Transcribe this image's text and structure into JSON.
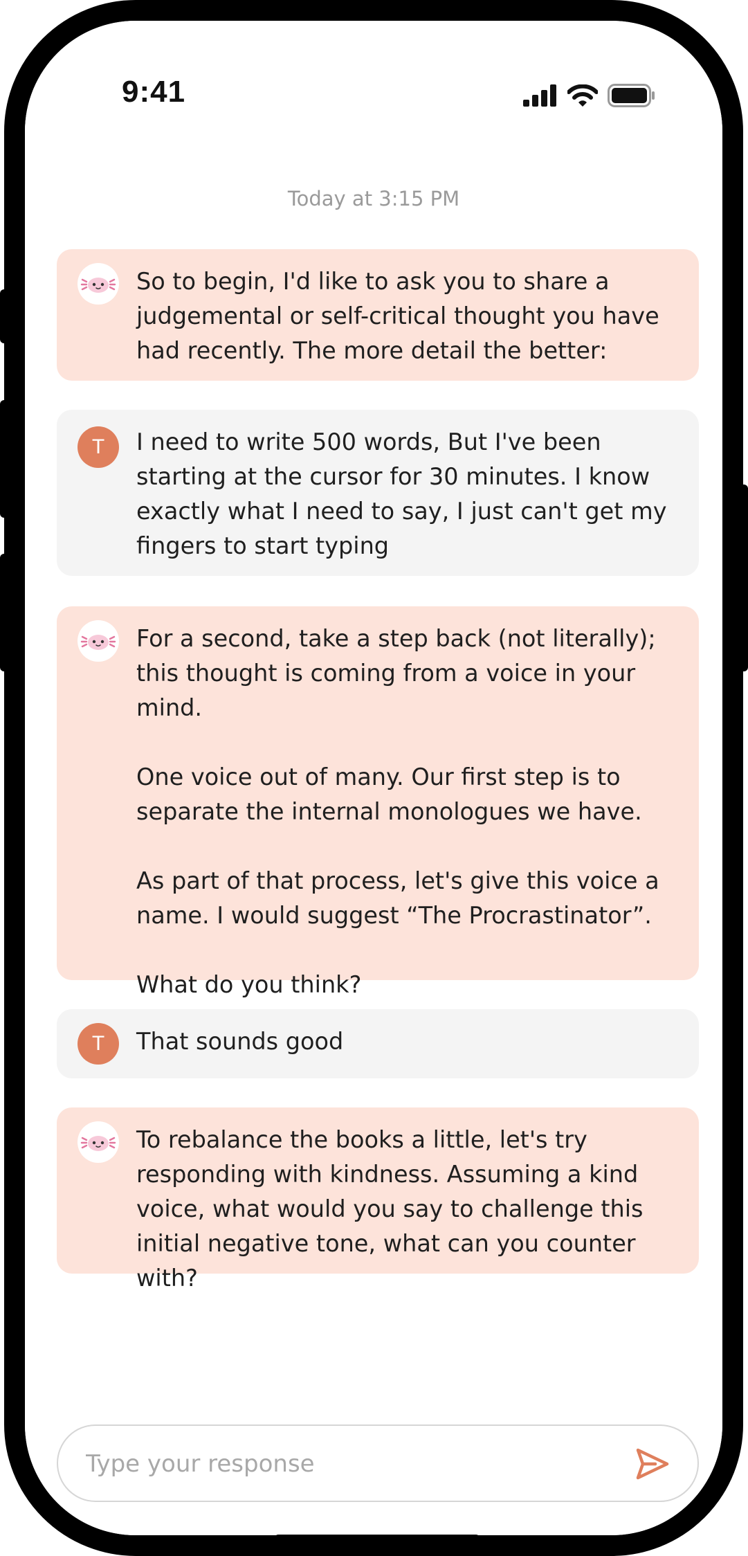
{
  "status_bar": {
    "time": "9:41",
    "icons": [
      "signal-icon",
      "wifi-icon",
      "battery-icon"
    ]
  },
  "conversation": {
    "timestamp": "Today at 3:15 PM",
    "messages": [
      {
        "sender": "bot",
        "avatar_icon": "axolotl-icon",
        "paragraphs": [
          "So to begin, I'd like to ask you to share a judgemental or self-critical thought you have had recently. The more detail the better:"
        ]
      },
      {
        "sender": "user",
        "avatar_initial": "T",
        "paragraphs": [
          "I need to write 500 words, But I've been starting at the cursor for 30 minutes. I know exactly what I need to say, I just can't get my fingers to start typing"
        ]
      },
      {
        "sender": "bot",
        "avatar_icon": "axolotl-icon",
        "paragraphs": [
          "For a second, take a step back (not literally); this thought is coming from a voice in your mind.",
          "One voice out of many. Our first step is to separate the internal monologues we have.",
          "As part of that process, let's give this voice a name. I would suggest “The Procrastinator”.",
          "What do you think?"
        ]
      },
      {
        "sender": "user",
        "avatar_initial": "T",
        "paragraphs": [
          "That sounds good"
        ]
      },
      {
        "sender": "bot",
        "avatar_icon": "axolotl-icon",
        "paragraphs": [
          "To rebalance the books a little, let's try responding with kindness. Assuming a kind voice, what would you say to challenge this initial negative tone, what can you counter with?"
        ]
      }
    ]
  },
  "composer": {
    "placeholder": "Type your response",
    "send_icon": "send-icon"
  },
  "colors": {
    "bot_bubble": "#fde3da",
    "user_bubble": "#f4f4f4",
    "user_avatar": "#df7f5c",
    "accent": "#df7f5c",
    "timestamp_text": "#9a9a9a"
  }
}
